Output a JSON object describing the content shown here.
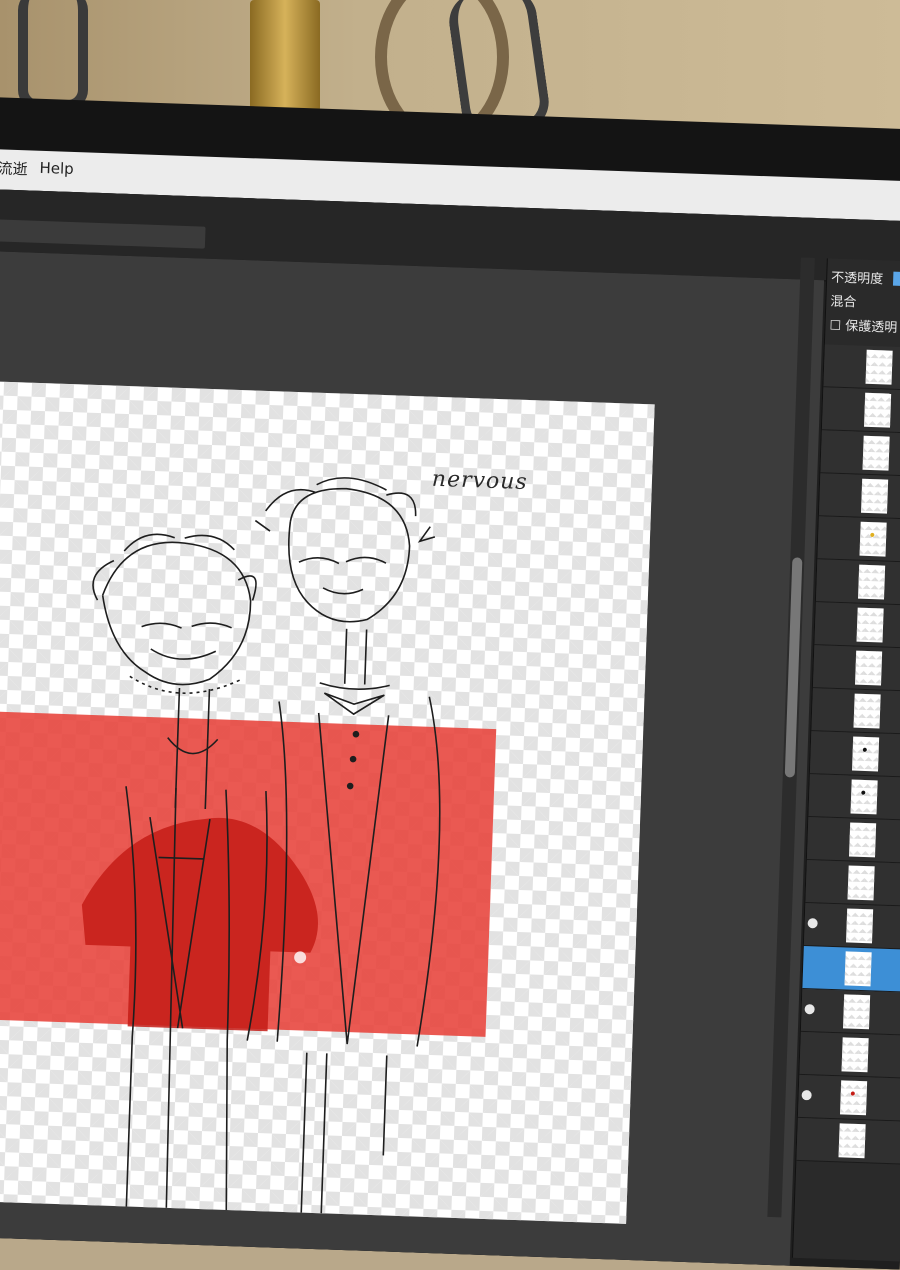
{
  "menu": {
    "items": [
      "流逝",
      "Help"
    ]
  },
  "canvas": {
    "annotation": "nervous"
  },
  "layer_panel": {
    "opacity_label": "不透明度",
    "blend_label": "混合",
    "preserve_label": "保護透明",
    "preserve_checked": false,
    "layers": [
      {
        "visible": false,
        "active": false,
        "mark": "sketch"
      },
      {
        "visible": false,
        "active": false,
        "mark": ""
      },
      {
        "visible": false,
        "active": false,
        "mark": ""
      },
      {
        "visible": false,
        "active": false,
        "mark": ""
      },
      {
        "visible": false,
        "active": false,
        "mark": "dot-yellow"
      },
      {
        "visible": false,
        "active": false,
        "mark": ""
      },
      {
        "visible": false,
        "active": false,
        "mark": ""
      },
      {
        "visible": false,
        "active": false,
        "mark": ""
      },
      {
        "visible": false,
        "active": false,
        "mark": ""
      },
      {
        "visible": false,
        "active": false,
        "mark": "dot-black"
      },
      {
        "visible": false,
        "active": false,
        "mark": "dot-black"
      },
      {
        "visible": false,
        "active": false,
        "mark": ""
      },
      {
        "visible": false,
        "active": false,
        "mark": ""
      },
      {
        "visible": true,
        "active": false,
        "mark": "sketch"
      },
      {
        "visible": false,
        "active": true,
        "mark": ""
      },
      {
        "visible": true,
        "active": false,
        "mark": "sketch"
      },
      {
        "visible": false,
        "active": false,
        "mark": "sketch"
      },
      {
        "visible": true,
        "active": false,
        "mark": "dot-red"
      },
      {
        "visible": false,
        "active": false,
        "mark": ""
      }
    ]
  },
  "colors": {
    "selection_fill": "#e8473f",
    "suit_fill": "#c41c16",
    "panel_highlight": "#3d8fd6",
    "opacity_swatch": "#5aa6e8"
  }
}
